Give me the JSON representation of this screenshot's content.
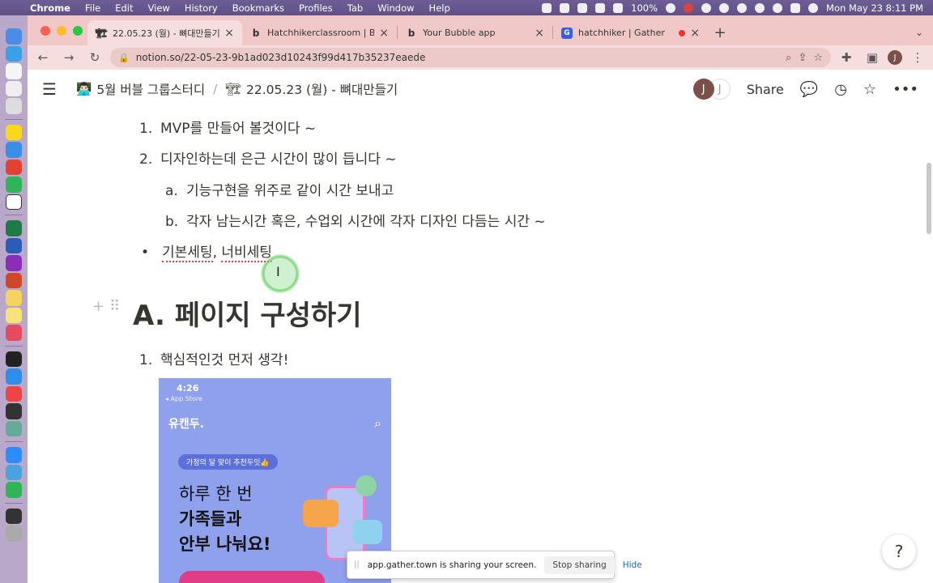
{
  "menubar": {
    "app": "Chrome",
    "items": [
      "File",
      "Edit",
      "View",
      "History",
      "Bookmarks",
      "Profiles",
      "Tab",
      "Window",
      "Help"
    ],
    "battery": "100%",
    "datetime": "Mon May 23  8:11 PM"
  },
  "tabs": [
    {
      "title": "22.05.23 (월) - 뼈대만들기",
      "favicon": "🏗",
      "active": true
    },
    {
      "title": "Hatchhikerclassroom | Bubble Ed",
      "favicon": "b",
      "active": false
    },
    {
      "title": "Your Bubble app",
      "favicon": "b",
      "active": false
    },
    {
      "title": "hatchhiker | Gather",
      "favicon": "G",
      "active": false
    }
  ],
  "toolbar": {
    "url": "notion.so/22-05-23-9b1ad023d10243f99d417b35237eaede",
    "avatar": "J"
  },
  "notion": {
    "breadcrumb": [
      {
        "emoji": "👨🏻‍💻",
        "label": "5월 버블 그룹스터디"
      },
      {
        "emoji": "🏗",
        "label": "22.05.23 (월) - 뼈대만들기"
      }
    ],
    "avatars": [
      "J",
      "J"
    ],
    "share": "Share"
  },
  "content": {
    "list1": [
      {
        "num": "1.",
        "text": "MVP를 만들어 볼것이다 ~"
      },
      {
        "num": "2.",
        "text": "디자인하는데 은근 시간이 많이 듭니다 ~"
      }
    ],
    "sublist": [
      {
        "num": "a.",
        "text": "기능구현을 위주로 같이 시간 보내고"
      },
      {
        "num": "b.",
        "text": "각자 남는시간 혹은, 수업외 시간에 각자 디자인 다듬는 시간 ~"
      }
    ],
    "bullet": {
      "part1": "기본세팅",
      "sep": ", ",
      "part2": "너비세팅"
    },
    "heading": "A. 페이지 구성하기",
    "list2": [
      {
        "num": "1.",
        "text": "핵심적인것 먼저 생각!"
      }
    ]
  },
  "phone_image": {
    "time": "4:26",
    "back": "◂ App Store",
    "brand": "유캔두.",
    "pill": "가정의 달 맞이 추천두잇👍",
    "line1": "하루 한 번",
    "line2": "가족들과",
    "line3": "안부 나눠요!"
  },
  "sharebar": {
    "message": "app.gather.town is sharing your screen.",
    "stop": "Stop sharing",
    "hide": "Hide"
  },
  "help": "?"
}
